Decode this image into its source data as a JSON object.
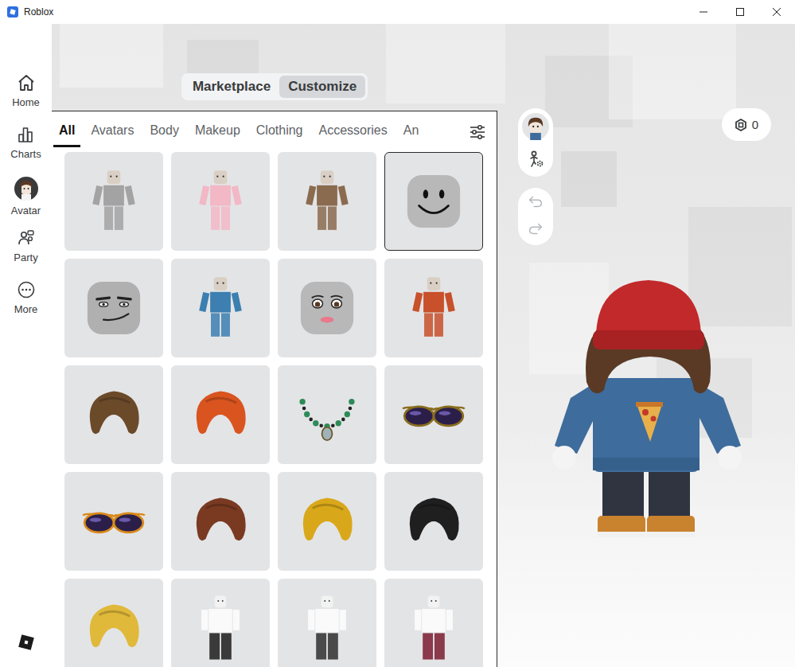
{
  "window": {
    "title": "Roblox"
  },
  "sidebar": {
    "items": [
      {
        "label": "Home",
        "kind": "home"
      },
      {
        "label": "Charts",
        "kind": "charts"
      },
      {
        "label": "Avatar",
        "kind": "avatar"
      },
      {
        "label": "Party",
        "kind": "party"
      },
      {
        "label": "More",
        "kind": "more"
      }
    ]
  },
  "mode_switch": [
    {
      "label": "Marketplace",
      "selected": false
    },
    {
      "label": "Customize",
      "selected": true
    }
  ],
  "tabs": [
    {
      "label": "All",
      "selected": true
    },
    {
      "label": "Avatars",
      "selected": false
    },
    {
      "label": "Body",
      "selected": false
    },
    {
      "label": "Makeup",
      "selected": false
    },
    {
      "label": "Clothing",
      "selected": false
    },
    {
      "label": "Accessories",
      "selected": false
    },
    {
      "label": "An",
      "selected": false
    }
  ],
  "tiles": [
    {
      "kind": "body",
      "color": "#a3a3a3",
      "selected": false
    },
    {
      "kind": "body",
      "color": "#f2b8c6",
      "selected": false
    },
    {
      "kind": "body",
      "color": "#8b6b4f",
      "selected": false
    },
    {
      "kind": "smileface",
      "color": "#b8b8b8",
      "selected": true
    },
    {
      "kind": "manface",
      "color": "#b0b0b0",
      "selected": false
    },
    {
      "kind": "body",
      "color": "#3c7fb0",
      "selected": false
    },
    {
      "kind": "womanface",
      "color": "#b8b8b8",
      "selected": false
    },
    {
      "kind": "body",
      "color": "#c8502a",
      "selected": false
    },
    {
      "kind": "hair",
      "color": "#6b4a2a",
      "selected": false
    },
    {
      "kind": "hair",
      "color": "#d9541f",
      "selected": false
    },
    {
      "kind": "necklace",
      "color": "#2e8b57",
      "selected": false
    },
    {
      "kind": "glasses",
      "color": "#8a6d1e",
      "selected": false
    },
    {
      "kind": "glasses",
      "color": "#d98a1a",
      "selected": false
    },
    {
      "kind": "hair",
      "color": "#7a3a22",
      "selected": false
    },
    {
      "kind": "hair",
      "color": "#d9a81a",
      "selected": false
    },
    {
      "kind": "hair",
      "color": "#1f1f1f",
      "selected": false
    },
    {
      "kind": "hair",
      "color": "#e0b93a",
      "selected": false
    },
    {
      "kind": "clothing",
      "color": "#3a3a3a",
      "selected": false
    },
    {
      "kind": "clothing",
      "color": "#4a4a4a",
      "selected": false
    },
    {
      "kind": "clothing",
      "color": "#8a3a4a",
      "selected": false
    }
  ],
  "history": [
    {
      "kind": "undo",
      "disabled": true
    },
    {
      "kind": "redo",
      "disabled": true
    }
  ],
  "robux": {
    "balance": "0"
  }
}
